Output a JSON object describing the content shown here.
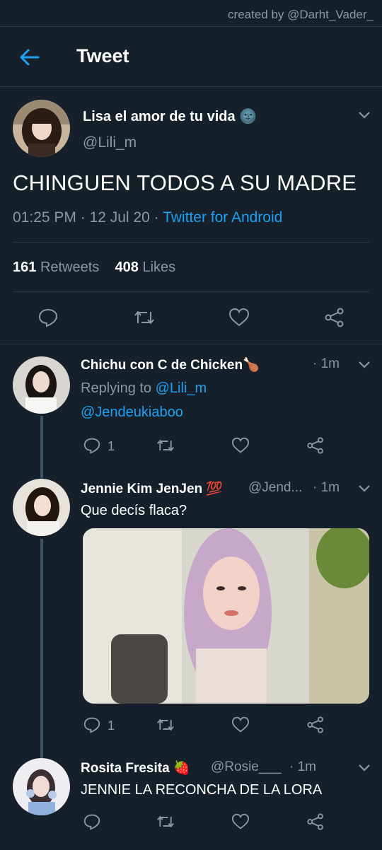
{
  "watermark": "created by @Darht_Vader_",
  "header": {
    "title": "Tweet"
  },
  "colors": {
    "background": "#15202b",
    "accent": "#1da1f2",
    "muted": "#8899a6",
    "divider": "#2a3945"
  },
  "icons": [
    "back-arrow-icon",
    "chevron-down-icon",
    "reply-icon",
    "retweet-icon",
    "like-icon",
    "share-icon"
  ],
  "main_tweet": {
    "display_name": "Lisa el amor de tu vida",
    "name_emoji": "🌚",
    "handle": "@Lili_m",
    "text": "CHINGUEN TODOS A SU MADRE",
    "time": "01:25 PM",
    "date": "12 Jul 20",
    "source": "Twitter for Android",
    "retweets_count": "161",
    "retweets_label": "Retweets",
    "likes_count": "408",
    "likes_label": "Likes"
  },
  "replies": [
    {
      "display_name": "Chichu con C de Chicken",
      "name_emoji": "🍗",
      "time": "· 1m",
      "replying_label": "Replying to",
      "replying_handle": "@Lili_m",
      "mention": "@Jendeukiaboo",
      "reply_count": "1"
    },
    {
      "display_name": "Jennie Kim JenJen",
      "name_emoji": "💯",
      "handle": "@Jend...",
      "time": "· 1m",
      "text": "Que decís flaca?",
      "reply_count": "1"
    },
    {
      "display_name": "Rosita Fresita",
      "name_emoji": "🍓",
      "handle": "@Rosie___",
      "time": "· 1m",
      "text": "JENNIE LA RECONCHA DE LA LORA"
    }
  ]
}
